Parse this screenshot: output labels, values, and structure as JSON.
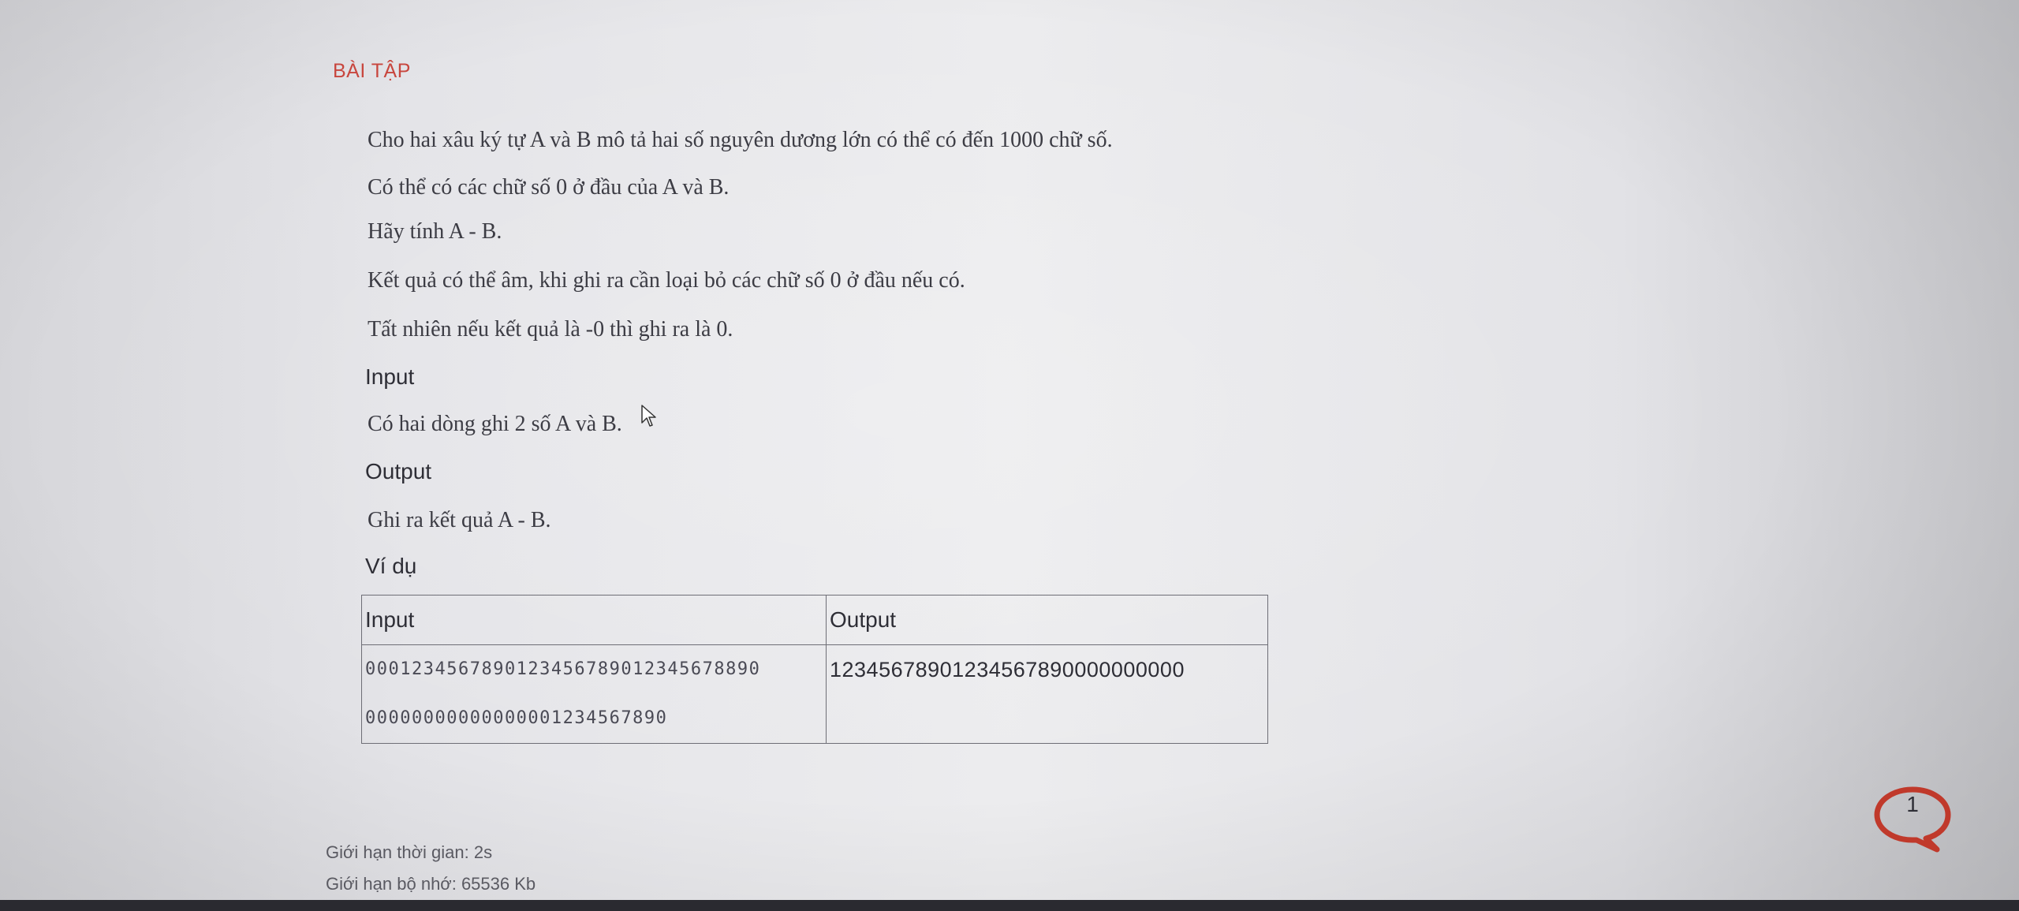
{
  "section": {
    "title": "BÀI TẬP"
  },
  "problem": {
    "statement": [
      "Cho hai xâu ký tự A và B mô tả hai số nguyên dương lớn có thể có đến 1000 chữ số.",
      "Có thể có các chữ số 0 ở đầu của A và B.",
      "Hãy tính A - B.",
      "Kết quả có thể âm, khi ghi ra cần loại bỏ các chữ số 0 ở đầu nếu có.",
      "Tất nhiên nếu kết quả là -0 thì ghi ra là 0."
    ],
    "input_heading": "Input",
    "input_text": "Có hai dòng ghi 2 số A và B.",
    "output_heading": "Output",
    "output_text": "Ghi ra kết quả A - B.",
    "example_heading": "Ví dụ"
  },
  "example_table": {
    "headers": [
      "Input",
      "Output"
    ],
    "input_lines": [
      "0001234567890123456789012345678890",
      "00000000000000001234567890"
    ],
    "output": "12345678901234567890000000000"
  },
  "limits": {
    "time": "Giới hạn thời gian: 2s",
    "memory": "Giới hạn bộ nhớ: 65536 Kb"
  },
  "notification": {
    "count": "1",
    "accent": "#c0392b"
  },
  "colors": {
    "title": "#c8463e",
    "text": "#3c3c44"
  }
}
